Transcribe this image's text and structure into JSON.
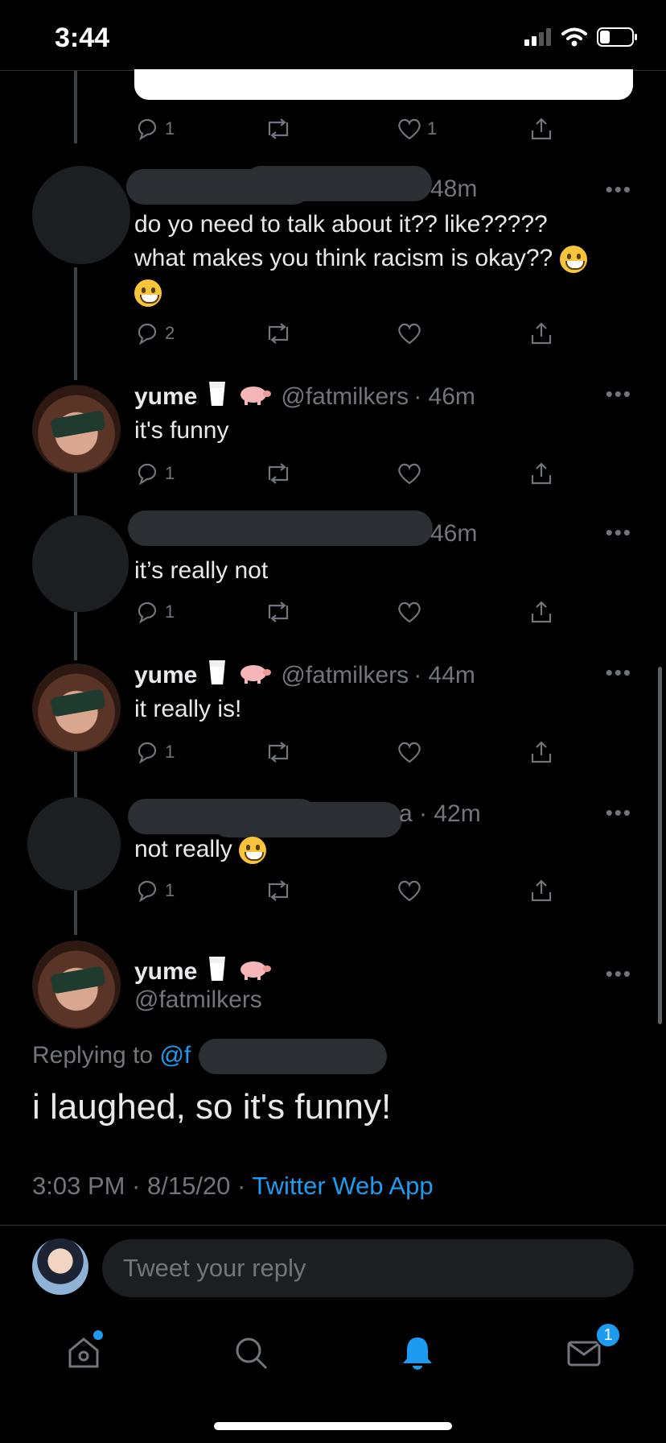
{
  "status_bar": {
    "time": "3:44"
  },
  "top_actions": {
    "reply_count": "1",
    "like_count": "1"
  },
  "tweets": [
    {
      "time": "48m",
      "text_line1": "do yo need to talk about it?? like?????",
      "text_line2": "what makes you think racism is okay??",
      "reply_count": "2"
    },
    {
      "name": "yume",
      "handle": "@fatmilkers",
      "time": "· 46m",
      "text": "it's funny",
      "reply_count": "1"
    },
    {
      "time": "46m",
      "text": "it’s really not",
      "reply_count": "1"
    },
    {
      "name": "yume",
      "handle": "@fatmilkers",
      "time": "· 44m",
      "text": "it really is!",
      "reply_count": "1"
    },
    {
      "time": "a · 42m",
      "text": "not really",
      "reply_count": "1"
    }
  ],
  "main_tweet": {
    "name": "yume",
    "handle": "@fatmilkers",
    "replying_label": "Replying to",
    "replying_mention": "@f",
    "text": "i laughed, so it's funny!",
    "meta": "3:03 PM · 8/15/20 ·",
    "app": "Twitter Web App"
  },
  "reply_bar": {
    "placeholder": "Tweet your reply"
  },
  "tab_bar": {
    "messages_badge": "1"
  },
  "icons": [
    "reply-icon",
    "retweet-icon",
    "like-icon",
    "share-icon",
    "more-icon",
    "home-icon",
    "search-icon",
    "bell-icon",
    "mail-icon",
    "wifi-icon",
    "battery-icon",
    "signal-icon"
  ],
  "colors": {
    "accent": "#1d9bf0",
    "muted": "#71767b",
    "background": "#000000"
  }
}
